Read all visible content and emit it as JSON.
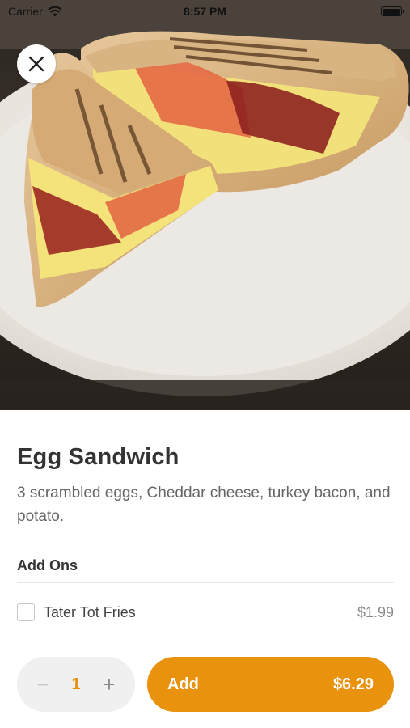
{
  "status_bar": {
    "carrier": "Carrier",
    "time": "8:57 PM"
  },
  "icons": {
    "close": "close-icon",
    "wifi": "wifi-icon",
    "battery": "battery-icon"
  },
  "item": {
    "name": "Egg Sandwich",
    "description": "3 scrambled eggs, Cheddar cheese, turkey bacon, and potato."
  },
  "add_ons": {
    "label": "Add Ons",
    "options": [
      {
        "name": "Tater Tot Fries",
        "price": "$1.99",
        "checked": false
      }
    ]
  },
  "order": {
    "minus": "−",
    "quantity": "1",
    "plus": "+",
    "add_label": "Add",
    "total": "$6.29"
  },
  "colors": {
    "accent": "#e8920e",
    "quantity_text": "#e58f0a",
    "stepper_bg": "#f0f0f0"
  }
}
